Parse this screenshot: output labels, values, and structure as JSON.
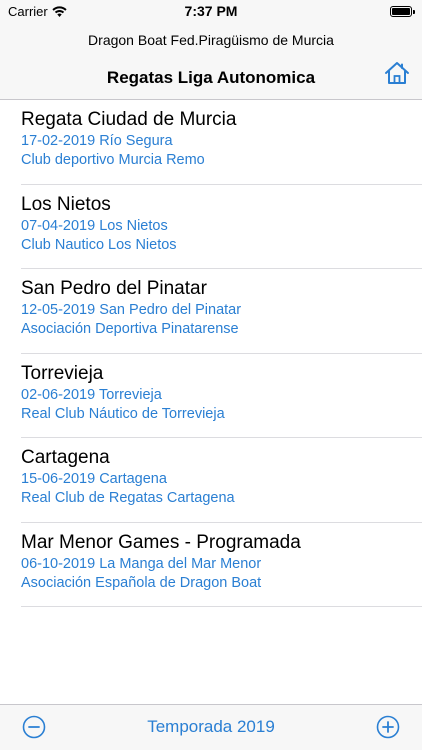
{
  "status_bar": {
    "carrier": "Carrier",
    "time": "7:37 PM",
    "battery_level": 1.0,
    "icons": [
      "wifi-icon",
      "battery-icon"
    ]
  },
  "header": {
    "subtitle": "Dragon Boat Fed.Piragüismo de Murcia",
    "title": "Regatas Liga Autonomica",
    "home_icon": "home-icon"
  },
  "regattas": [
    {
      "name": "Regata Ciudad de Murcia",
      "date_location": "17-02-2019 Río Segura",
      "organizer": "Club deportivo Murcia Remo"
    },
    {
      "name": "Los Nietos",
      "date_location": "07-04-2019 Los Nietos",
      "organizer": "Club Nautico Los Nietos"
    },
    {
      "name": "San Pedro del Pinatar",
      "date_location": "12-05-2019 San Pedro del Pinatar",
      "organizer": "Asociación Deportiva Pinatarense"
    },
    {
      "name": "Torrevieja",
      "date_location": "02-06-2019 Torrevieja",
      "organizer": "Real Club Náutico de Torrevieja"
    },
    {
      "name": "Cartagena",
      "date_location": "15-06-2019 Cartagena",
      "organizer": "Real Club de Regatas Cartagena"
    },
    {
      "name": "Mar Menor Games - Programada",
      "date_location": "06-10-2019 La Manga del Mar Menor",
      "organizer": "Asociación Española de Dragon Boat"
    }
  ],
  "toolbar": {
    "season_label": "Temporada 2019",
    "prev_icon": "minus-circle-icon",
    "next_icon": "plus-circle-icon"
  },
  "colors": {
    "accent": "#2a7fd3",
    "bar_background": "#f7f7f7",
    "separator": "#dcdce0"
  }
}
